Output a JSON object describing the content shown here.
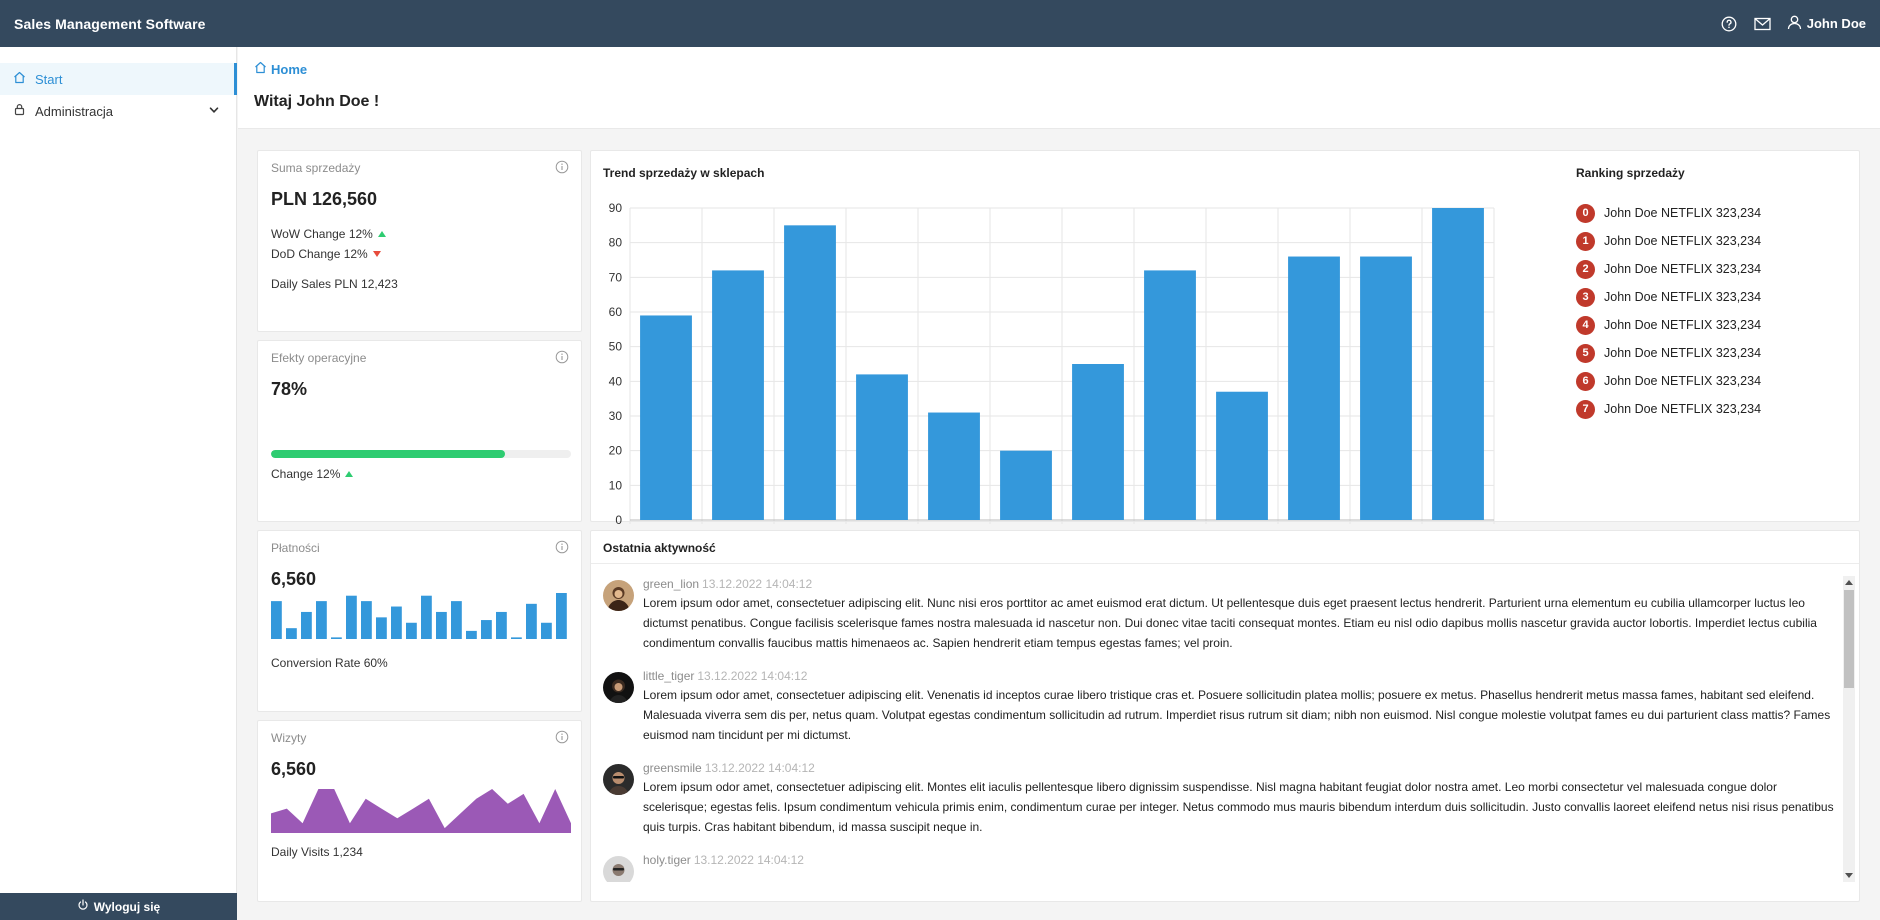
{
  "app": {
    "title": "Sales Management Software"
  },
  "topbar": {
    "user_name": "John Doe"
  },
  "sidebar": {
    "items": [
      {
        "label": "Start"
      },
      {
        "label": "Administracja"
      }
    ],
    "logout_label": "Wyloguj się"
  },
  "header": {
    "breadcrumb": "Home",
    "title": "Witaj John Doe !"
  },
  "cards": {
    "sales": {
      "title": "Suma sprzedaży",
      "value": "PLN 126,560",
      "wow": "WoW Change 12%",
      "dod": "DoD Change 12%",
      "daily": "Daily Sales PLN 12,423"
    },
    "ops": {
      "title": "Efekty operacyjne",
      "value": "78%",
      "progress": 0.78,
      "change": "Change 12%"
    },
    "payments": {
      "title": "Płatności",
      "value": "6,560",
      "bars": [
        7,
        2,
        5,
        7,
        0.3,
        8,
        7,
        4,
        6,
        3,
        8,
        5,
        7,
        1.5,
        3.5,
        5,
        0.3,
        6.5,
        3,
        8.5
      ],
      "conversion": "Conversion Rate 60%"
    },
    "visits": {
      "title": "Wizyty",
      "value": "6,560",
      "area": [
        4,
        5,
        2,
        9,
        9,
        2,
        7,
        5,
        3,
        5,
        7,
        1,
        4,
        7,
        9,
        6,
        8,
        2,
        9,
        2
      ],
      "daily": "Daily Visits 1,234"
    }
  },
  "trend": {
    "title": "Trend sprzedaży w sklepach",
    "chart_data": {
      "type": "bar",
      "title": "",
      "xlabel": "",
      "ylabel": "",
      "categories": [
        "",
        "",
        "",
        "",
        "",
        "",
        "",
        "",
        "",
        "",
        "",
        ""
      ],
      "values": [
        59,
        72,
        85,
        42,
        31,
        20,
        45,
        72,
        37,
        76,
        76,
        90
      ],
      "ylim": [
        0,
        90
      ],
      "yticks": [
        "0",
        "10",
        "20",
        "30",
        "40",
        "50",
        "60",
        "70",
        "80",
        "90"
      ],
      "grid": true,
      "color": "#3498db"
    }
  },
  "ranking": {
    "title": "Ranking sprzedaży",
    "items": [
      {
        "rank": "0",
        "label": "John Doe NETFLIX 323,234"
      },
      {
        "rank": "1",
        "label": "John Doe NETFLIX 323,234"
      },
      {
        "rank": "2",
        "label": "John Doe NETFLIX 323,234"
      },
      {
        "rank": "3",
        "label": "John Doe NETFLIX 323,234"
      },
      {
        "rank": "4",
        "label": "John Doe NETFLIX 323,234"
      },
      {
        "rank": "5",
        "label": "John Doe NETFLIX 323,234"
      },
      {
        "rank": "6",
        "label": "John Doe NETFLIX 323,234"
      },
      {
        "rank": "7",
        "label": "John Doe NETFLIX 323,234"
      }
    ]
  },
  "activity": {
    "title": "Ostatnia aktywność",
    "items": [
      {
        "user": "green_lion",
        "time": "13.12.2022 14:04:12",
        "text": "Lorem ipsum odor amet, consectetuer adipiscing elit. Nunc nisi eros porttitor ac amet euismod erat dictum. Ut pellentesque duis eget praesent lectus hendrerit. Parturient urna elementum eu cubilia ullamcorper luctus leo dictumst penatibus. Congue facilisis scelerisque fames nostra malesuada id nascetur non. Dui donec vitae taciti consequat montes. Etiam eu nisl odio dapibus mollis nascetur gravida auctor lobortis. Imperdiet lectus cubilia condimentum convallis faucibus mattis himenaeos ac. Sapien hendrerit etiam tempus egestas fames; vel proin."
      },
      {
        "user": "little_tiger",
        "time": "13.12.2022 14:04:12",
        "text": "Lorem ipsum odor amet, consectetuer adipiscing elit. Venenatis id inceptos curae libero tristique cras et. Posuere sollicitudin platea mollis; posuere ex metus. Phasellus hendrerit metus massa fames, habitant sed eleifend. Malesuada viverra sem dis per, netus quam. Volutpat egestas condimentum sollicitudin ad rutrum. Imperdiet risus rutrum sit diam; nibh non euismod. Nisl congue molestie volutpat fames eu dui parturient class mattis? Fames euismod nam tincidunt per mi dictumst."
      },
      {
        "user": "greensmile",
        "time": "13.12.2022 14:04:12",
        "text": "Lorem ipsum odor amet, consectetuer adipiscing elit. Montes elit iaculis pellentesque libero dignissim suspendisse. Nisl magna habitant feugiat dolor nostra amet. Leo morbi consectetur vel malesuada congue dolor scelerisque; egestas felis. Ipsum condimentum vehicula primis enim, condimentum curae per integer. Netus commodo mus mauris bibendum interdum duis sollicitudin. Justo convallis laoreet eleifend netus nisi risus penatibus quis turpis. Cras habitant bibendum, id massa suscipit neque in."
      },
      {
        "user": "holy.tiger",
        "time": "13.12.2022 14:04:12",
        "text": ""
      }
    ]
  },
  "colors": {
    "topbar": "#34495e",
    "accent": "#2d8fd5",
    "bar": "#3498db",
    "progress": "#2ecc71",
    "area": "#9b59b6",
    "rank_badge": "#c0392b"
  }
}
